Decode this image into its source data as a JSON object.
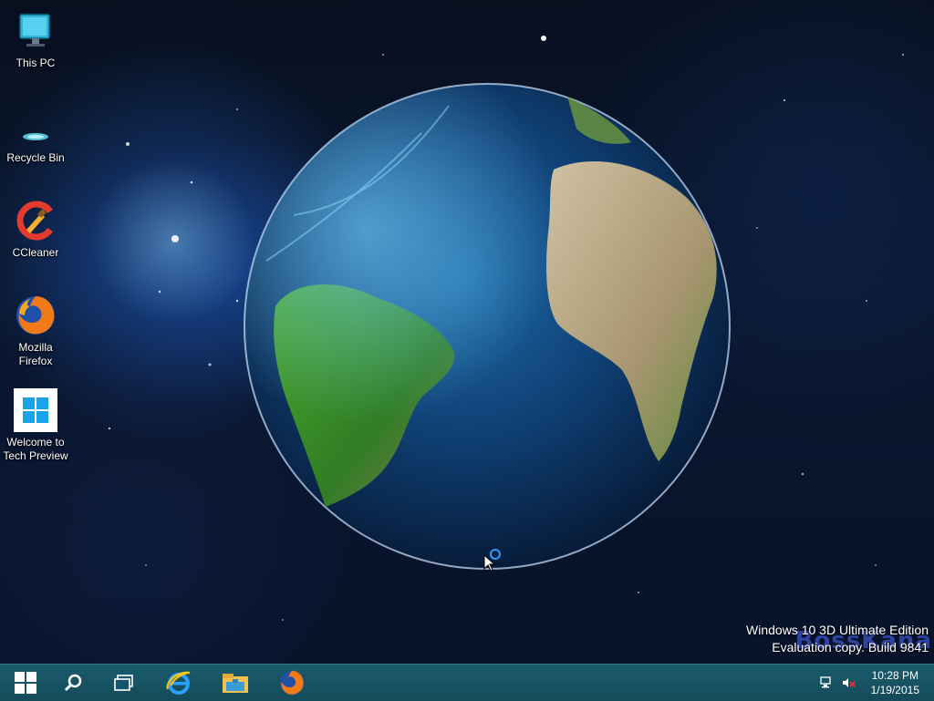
{
  "desktop": {
    "icons": [
      {
        "label": "This PC",
        "icon": "monitor-icon"
      },
      {
        "label": "Recycle Bin",
        "icon": "recycle-bin-icon"
      },
      {
        "label": "CCleaner",
        "icon": "ccleaner-icon"
      },
      {
        "label": "Mozilla Firefox",
        "icon": "firefox-icon"
      },
      {
        "label": "Welcome to Tech Preview",
        "icon": "windows-logo-icon"
      }
    ],
    "wallpaper": "earth-globe-space"
  },
  "watermark": {
    "line1": "Windows 10 3D Ultimate Edition",
    "line2": "Evaluation copy. Build 9841",
    "brand": "BossKana"
  },
  "taskbar": {
    "buttons": [
      "start-icon",
      "search-icon",
      "task-view-icon",
      "internet-explorer-icon",
      "file-explorer-icon",
      "firefox-icon"
    ],
    "tray": [
      "network-icon",
      "volume-muted-icon"
    ],
    "clock": {
      "time": "10:28 PM",
      "date": "1/19/2015"
    }
  },
  "colors": {
    "taskbar": "#17566a",
    "accent": "#2aa0ff"
  }
}
